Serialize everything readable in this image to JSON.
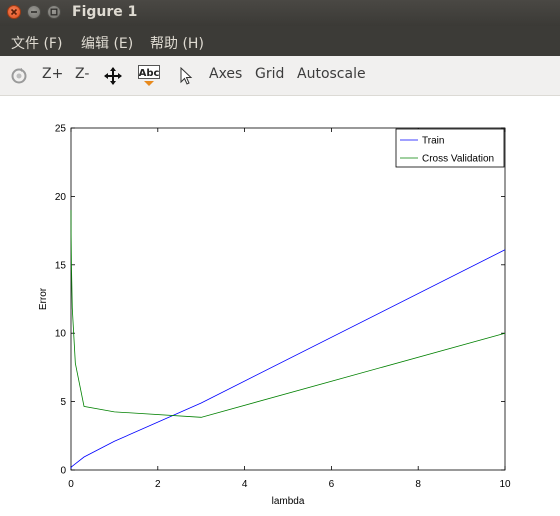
{
  "window": {
    "title": "Figure 1"
  },
  "menu": {
    "items": [
      "文件 (F)",
      "编辑 (E)",
      "帮助 (H)"
    ]
  },
  "toolbar": {
    "rotate_icon": "rotate-icon",
    "zoom_in": "Z+",
    "zoom_out": "Z-",
    "pan_icon": "pan-move-icon",
    "text_icon_label": "Abc",
    "select_icon": "pointer-arrow-icon",
    "axes": "Axes",
    "grid": "Grid",
    "autoscale": "Autoscale"
  },
  "chart_data": {
    "type": "line",
    "title": "",
    "xlabel": "lambda",
    "ylabel": "Error",
    "xlim": [
      0,
      10
    ],
    "ylim": [
      0,
      25
    ],
    "xticks": [
      0,
      2,
      4,
      6,
      8,
      10
    ],
    "yticks": [
      0,
      5,
      10,
      15,
      20,
      25
    ],
    "grid": false,
    "legend_position": "top-right",
    "series": [
      {
        "name": "Train",
        "color": "#0000ff",
        "x": [
          0,
          0.001,
          0.003,
          0.01,
          0.03,
          0.1,
          0.3,
          1,
          3,
          10
        ],
        "y": [
          0.1,
          0.12,
          0.17,
          0.22,
          0.28,
          0.45,
          0.95,
          2.1,
          4.9,
          16.1
        ]
      },
      {
        "name": "Cross Validation",
        "color": "#008000",
        "x": [
          0,
          0.001,
          0.003,
          0.01,
          0.03,
          0.1,
          0.3,
          1,
          3,
          10
        ],
        "y": [
          19.0,
          18.0,
          17.0,
          15.0,
          11.8,
          7.8,
          4.65,
          4.25,
          3.85,
          10.0
        ]
      }
    ]
  }
}
